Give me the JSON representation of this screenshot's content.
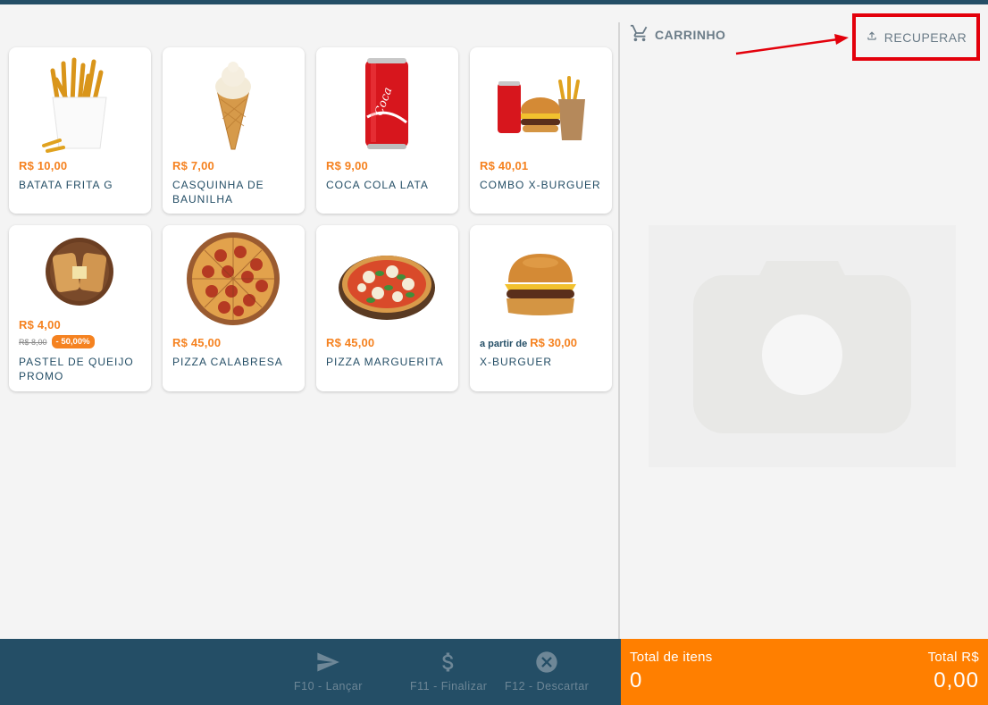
{
  "cart": {
    "title": "CARRINHO",
    "recover_label": "RECUPERAR"
  },
  "products": [
    {
      "price": "R$ 10,00",
      "name": "BATATA FRITA G",
      "image": "fries"
    },
    {
      "price": "R$ 7,00",
      "name": "CASQUINHA DE BAUNILHA",
      "image": "ice-cream-cone"
    },
    {
      "price": "R$ 9,00",
      "name": "COCA COLA LATA",
      "image": "soda-can"
    },
    {
      "price": "R$ 40,01",
      "name": "COMBO X-BURGUER",
      "image": "burger-combo"
    },
    {
      "price": "R$ 4,00",
      "old_price": "R$ 8,00",
      "discount": "- 50,00%",
      "name": "PASTEL DE QUEIJO PROMO",
      "image": "pastel"
    },
    {
      "price": "R$ 45,00",
      "name": "PIZZA CALABRESA",
      "image": "pizza-calabresa"
    },
    {
      "price": "R$ 45,00",
      "name": "PIZZA MARGUERITA",
      "image": "pizza-margherita"
    },
    {
      "price_prefix": "a partir de",
      "price": "R$ 30,00",
      "name": "X-BURGUER",
      "image": "cheeseburger"
    }
  ],
  "footer": {
    "launch": "F10 - Lançar",
    "finish": "F11 - Finalizar",
    "discard": "F12 - Descartar"
  },
  "totals": {
    "items_label": "Total de itens",
    "items_value": "0",
    "amount_label": "Total R$",
    "amount_value": "0,00"
  },
  "colors": {
    "accent": "#f58220",
    "primary": "#244e66",
    "highlight": "#e3000b"
  }
}
